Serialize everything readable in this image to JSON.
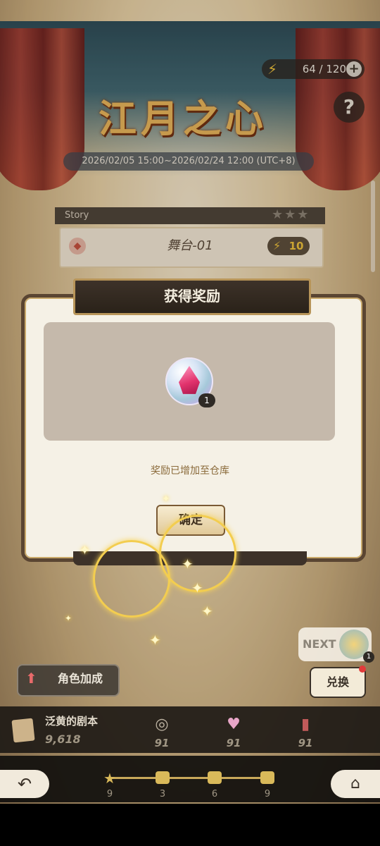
{
  "header": {
    "title_art": "江月之心",
    "date_range": "2026/02/05 15:00~2026/02/24 12:00 (UTC+8)",
    "energy_value": "64 / 120",
    "energy_icon": "lightning-icon",
    "help_label": "?"
  },
  "story": {
    "label": "Story",
    "stars": "★★★",
    "stage_name": "舞台-01",
    "stage_cost": "10"
  },
  "dialog": {
    "title": "获得奖励",
    "reward_count": "1",
    "reward_icon": "pink-gem-icon",
    "message": "奖励已增加至仓库",
    "confirm_label": "确定"
  },
  "side": {
    "next_label": "NEXT",
    "next_count": "1",
    "exchange_label": "兑换",
    "role_bonus_label": "角色加成"
  },
  "resources": {
    "main_label": "泛黄的剧本",
    "main_value": "9,618",
    "items": [
      {
        "icon": "necklace-icon",
        "value": "91"
      },
      {
        "icon": "potion-icon",
        "value": "91"
      },
      {
        "icon": "card-icon",
        "value": "91"
      }
    ]
  },
  "progress": {
    "nodes": [
      "9",
      "3",
      "6",
      "9"
    ]
  },
  "colors": {
    "accent_gold": "#c9a95a",
    "dialog_frame": "#5a4532",
    "energy_yellow": "#f0c43a"
  }
}
